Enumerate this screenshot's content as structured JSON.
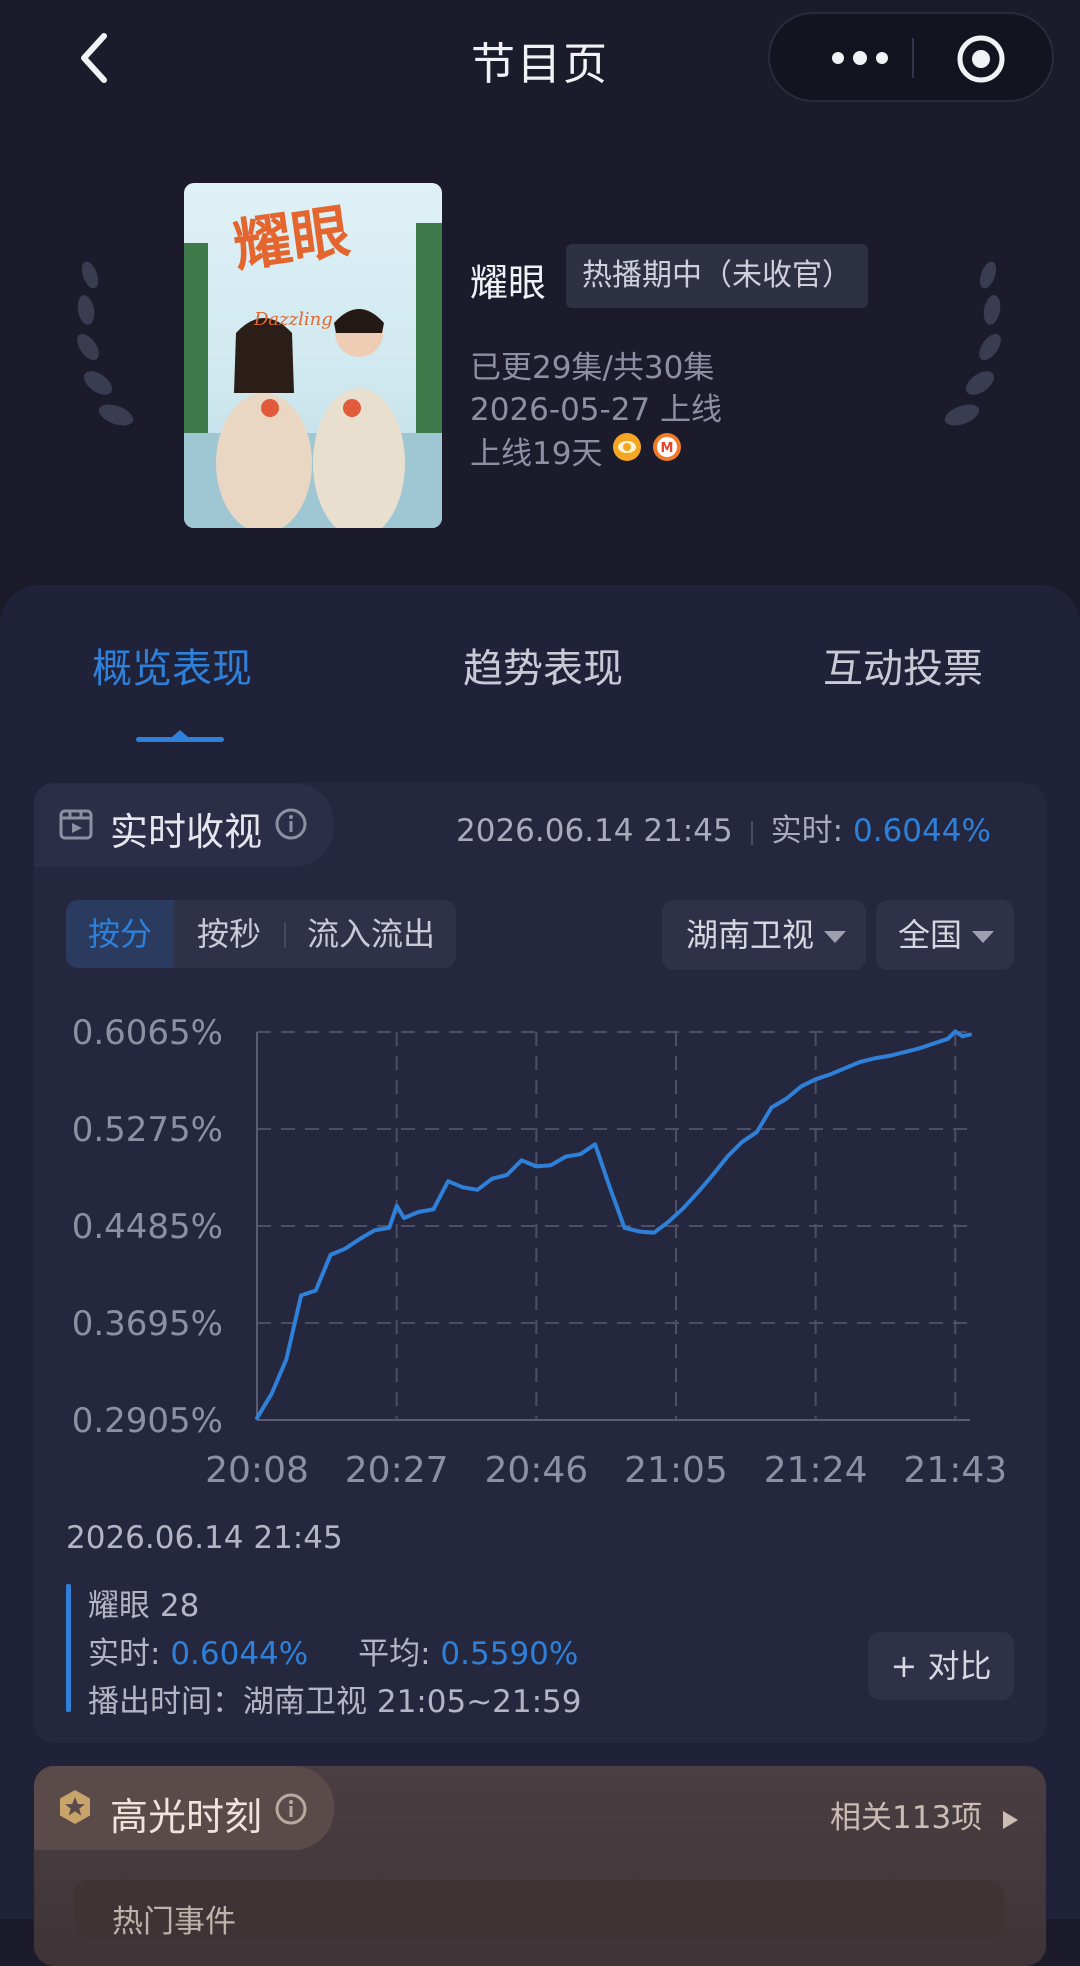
{
  "topbar": {
    "title": "节目页"
  },
  "show": {
    "name": "耀眼",
    "status": "热播期中（未收官）",
    "episodes": "已更29集/共30集",
    "premiere": "2026-05-27 上线",
    "days_online": "上线19天",
    "poster_title": "耀眼",
    "poster_subtitle": "Dazzling",
    "channel_icons": [
      "mango-tv-icon",
      "hunan-tv-icon"
    ]
  },
  "tabs": [
    {
      "label": "概览表现",
      "active": true
    },
    {
      "label": "趋势表现",
      "active": false
    },
    {
      "label": "互动投票",
      "active": false
    }
  ],
  "ratings_card": {
    "title": "实时收视",
    "timestamp": "2026.06.14 21:45",
    "realtime_label": "实时:",
    "realtime_value": "0.6044%",
    "segments": [
      "按分",
      "按秒",
      "流入流出"
    ],
    "channel_dropdown": "湖南卫视",
    "region_dropdown": "全国"
  },
  "chart_data": {
    "type": "line",
    "title": "",
    "xlabel": "",
    "ylabel": "",
    "x_ticks": [
      "20:08",
      "20:27",
      "20:46",
      "21:05",
      "21:24",
      "21:43"
    ],
    "y_ticks": [
      "0.6065%",
      "0.5275%",
      "0.4485%",
      "0.3695%",
      "0.2905%"
    ],
    "ylim": [
      0.2905,
      0.6065
    ],
    "xlim": [
      "20:08",
      "21:45"
    ],
    "grid": true,
    "series": [
      {
        "color": "#2e80d8",
        "x": [
          "20:08",
          "20:10",
          "20:12",
          "20:14",
          "20:16",
          "20:18",
          "20:20",
          "20:22",
          "20:24",
          "20:26",
          "20:27",
          "20:28",
          "20:30",
          "20:32",
          "20:34",
          "20:36",
          "20:38",
          "20:40",
          "20:42",
          "20:44",
          "20:46",
          "20:48",
          "20:50",
          "20:52",
          "20:54",
          "20:56",
          "20:58",
          "21:00",
          "21:02",
          "21:04",
          "21:06",
          "21:08",
          "21:10",
          "21:12",
          "21:14",
          "21:16",
          "21:18",
          "21:20",
          "21:22",
          "21:24",
          "21:26",
          "21:28",
          "21:30",
          "21:32",
          "21:34",
          "21:36",
          "21:38",
          "21:40",
          "21:42",
          "21:43",
          "21:44",
          "21:45"
        ],
        "y": [
          0.292,
          0.312,
          0.34,
          0.392,
          0.396,
          0.425,
          0.43,
          0.438,
          0.445,
          0.447,
          0.465,
          0.455,
          0.46,
          0.462,
          0.485,
          0.48,
          0.478,
          0.487,
          0.49,
          0.502,
          0.497,
          0.498,
          0.505,
          0.507,
          0.515,
          0.48,
          0.447,
          0.444,
          0.443,
          0.452,
          0.463,
          0.476,
          0.49,
          0.505,
          0.517,
          0.525,
          0.545,
          0.552,
          0.562,
          0.568,
          0.572,
          0.577,
          0.582,
          0.585,
          0.587,
          0.59,
          0.593,
          0.597,
          0.601,
          0.607,
          0.603,
          0.6044
        ]
      }
    ]
  },
  "detail": {
    "date": "2026.06.14 21:45",
    "episode": "耀眼 28",
    "realtime_label": "实时:",
    "realtime_value": "0.6044%",
    "avg_label": "平均:",
    "avg_value": "0.5590%",
    "air_time": "播出时间：湖南卫视 21:05~21:59",
    "compare_label": "+ 对比"
  },
  "highlights": {
    "title": "高光时刻",
    "related": "相关113项",
    "sub_text": "热门事件"
  },
  "colors": {
    "accent": "#2e80d8",
    "background": "#1b1b2c",
    "panel": "#20223a"
  }
}
